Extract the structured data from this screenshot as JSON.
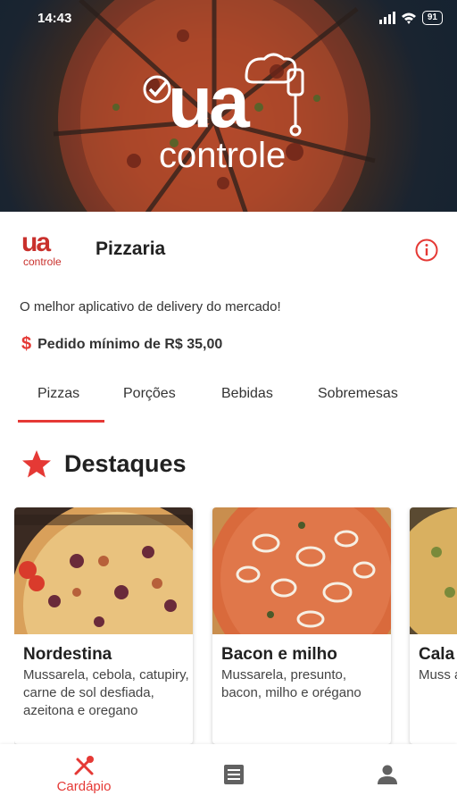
{
  "status_bar": {
    "time": "14:43",
    "battery": "91"
  },
  "brand": {
    "word": "ua",
    "sub": "controle"
  },
  "store": {
    "name": "Pizzaria",
    "tagline": "O melhor aplicativo de delivery do mercado!",
    "min_order": "Pedido mínimo de R$ 35,00",
    "currency_symbol": "$"
  },
  "tabs": [
    {
      "label": "Pizzas",
      "active": true
    },
    {
      "label": "Porções",
      "active": false
    },
    {
      "label": "Bebidas",
      "active": false
    },
    {
      "label": "Sobremesas",
      "active": false
    }
  ],
  "highlights": {
    "title": "Destaques",
    "items": [
      {
        "name": "Nordestina",
        "desc": "Mussarela, cebola, catupiry, carne de sol desfiada, azeitona e oregano"
      },
      {
        "name": "Bacon e milho",
        "desc": "Mussarela, presunto, bacon, milho e orégano"
      },
      {
        "name": "Cala",
        "desc": "Muss azeito"
      }
    ]
  },
  "bottom_nav": {
    "menu_label": "Cardápio"
  },
  "colors": {
    "accent": "#e53935",
    "brand_red": "#c9302c"
  },
  "icons": {
    "info": "info-icon",
    "star": "star-icon",
    "menu": "cutlery-icon",
    "orders": "receipt-icon",
    "profile": "person-icon"
  }
}
